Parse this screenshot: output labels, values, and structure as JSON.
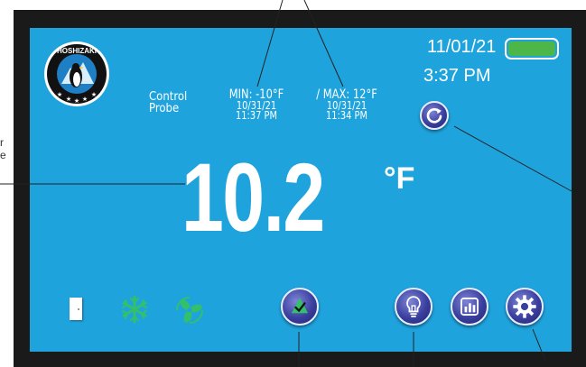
{
  "side_labels": {
    "line1": "r",
    "line2": "e"
  },
  "brand": {
    "logo_text": "HOSHIZAKI"
  },
  "probe": {
    "line1": "Control",
    "line2": "Probe"
  },
  "min": {
    "value": "MIN: -10°F",
    "date": "10/31/21",
    "time": "11:37 PM"
  },
  "max": {
    "value": "/ MAX: 12°F",
    "date": "10/31/21",
    "time": "11:34 PM"
  },
  "header": {
    "date": "11/01/21",
    "time": "3:37 PM"
  },
  "battery": {
    "level": 1.0,
    "color": "#4cb748"
  },
  "reading": {
    "temperature": "10.2",
    "unit": "°F"
  },
  "icons": {
    "door": "door-icon",
    "defrost": "snowflake-icon",
    "fan": "fan-icon",
    "refresh": "refresh-icon",
    "alarm": "alarm-check-icon",
    "light": "lightbulb-icon",
    "chart": "bar-chart-icon",
    "settings": "gear-icon"
  },
  "colors": {
    "screen": "#1fa3dd",
    "bezel": "#1a1a1a",
    "button": "#3a3f9e",
    "indicator_green": "#33c06a"
  }
}
